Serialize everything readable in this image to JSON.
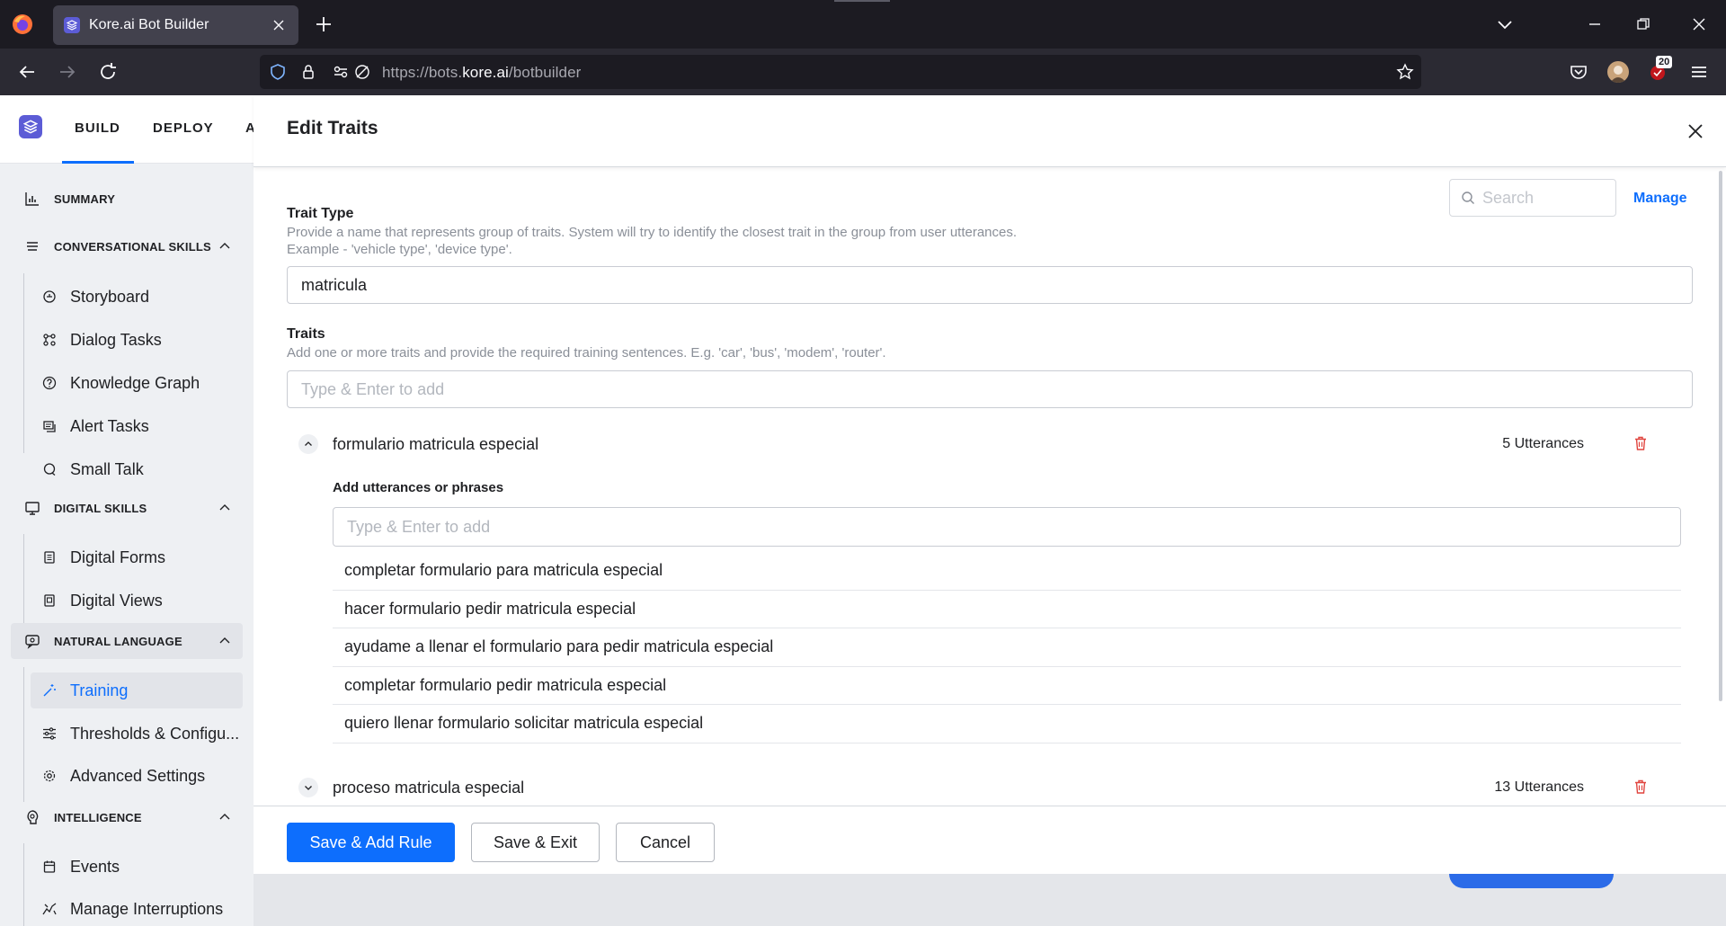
{
  "browser": {
    "tab_title": "Kore.ai Bot Builder",
    "url_prefix": "https://bots.",
    "url_domain": "kore.ai",
    "url_path": "/botbuilder",
    "extension_badge": "20"
  },
  "app": {
    "top_tabs": [
      "BUILD",
      "DEPLOY",
      "A"
    ],
    "sidebar": {
      "summary": "SUMMARY",
      "conversational_skills": "CONVERSATIONAL SKILLS",
      "conversational_items": [
        "Storyboard",
        "Dialog Tasks",
        "Knowledge Graph",
        "Alert Tasks",
        "Small Talk"
      ],
      "digital_skills": "DIGITAL SKILLS",
      "digital_items": [
        "Digital Forms",
        "Digital Views"
      ],
      "natural_language": "NATURAL LANGUAGE",
      "natural_items": [
        "Training",
        "Thresholds & Configu...",
        "Advanced Settings"
      ],
      "intelligence": "INTELLIGENCE",
      "intelligence_items": [
        "Events",
        "Manage Interruptions"
      ]
    }
  },
  "modal": {
    "title": "Edit Traits",
    "search_placeholder": "Search",
    "manage_label": "Manage",
    "trait_type_label": "Trait Type",
    "trait_type_help_1": "Provide a name that represents group of traits. System will try to identify the closest trait in the group from user utterances.",
    "trait_type_help_2": "Example - 'vehicle type', 'device type'.",
    "trait_type_value": "matricula",
    "traits_label": "Traits",
    "traits_help": "Add one or more traits and provide the required training sentences. E.g. 'car', 'bus', 'modem', 'router'.",
    "traits_placeholder": "Type & Enter to add",
    "traits": [
      {
        "name": "formulario matricula especial",
        "count": "5 Utterances",
        "expanded": true,
        "utterances_label": "Add utterances or phrases",
        "utterance_placeholder": "Type & Enter to add",
        "utterances": [
          "completar formulario para matricula especial",
          "hacer formulario pedir matricula especial",
          "ayudame a llenar el formulario para pedir matricula especial",
          "completar formulario pedir matricula especial",
          "quiero llenar formulario solicitar matricula especial"
        ]
      },
      {
        "name": "proceso matricula especial",
        "count": "13 Utterances",
        "expanded": false
      }
    ],
    "buttons": {
      "save_add_rule": "Save & Add Rule",
      "save_exit": "Save & Exit",
      "cancel": "Cancel"
    }
  },
  "colors": {
    "primary": "#0d6efd",
    "delete": "#e0443e",
    "sidebar_bg": "#eef0f3",
    "browser_bg": "#1c1b22"
  }
}
